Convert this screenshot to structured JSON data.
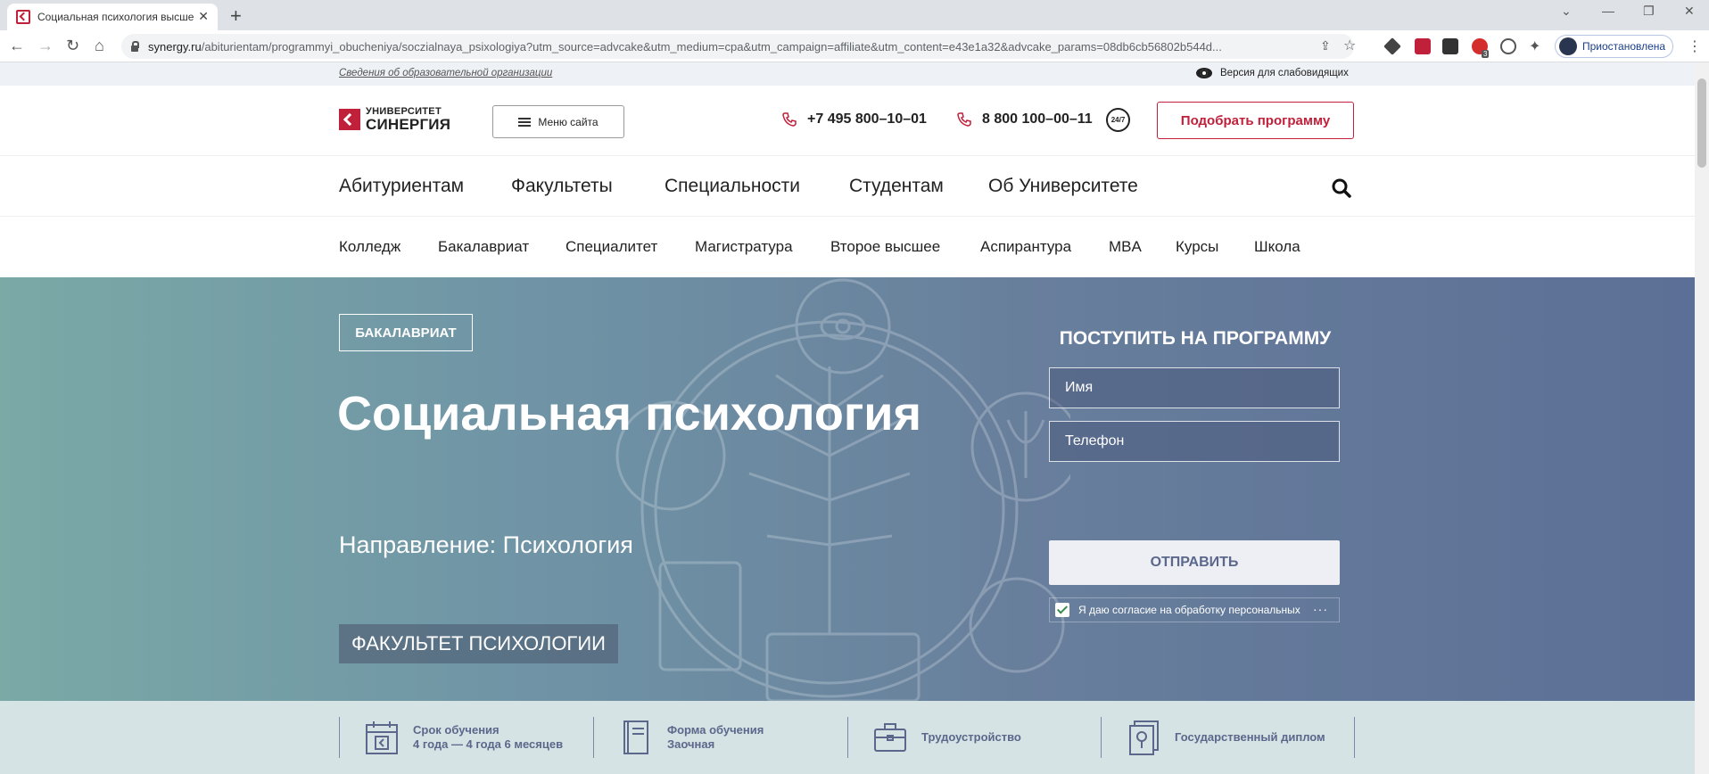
{
  "browser": {
    "tab_title": "Социальная психология высше",
    "url_host": "synergy.ru",
    "url_path": "/abiturientam/programmyi_obucheniya/soczialnaya_psixologiya?utm_source=advcake&utm_medium=cpa&utm_campaign=affiliate&utm_content=e43e1a32&advcake_params=08db6cb56802b544d...",
    "profile_label": "Приостановлена",
    "extension_badge": "3"
  },
  "infobar": {
    "org_info_link": "Сведения об образовательной организации",
    "vision_link": "Версия для слабовидящих"
  },
  "header": {
    "logo_line1": "УНИВЕРСИТЕТ",
    "logo_line2": "СИНЕРГИЯ",
    "menu_label": "Меню сайта",
    "phone1": "+7 495 800–10–01",
    "phone2": "8 800 100–00–11",
    "clock_label": "24/7",
    "cta_label": "Подобрать программу"
  },
  "main_nav": [
    "Абитуриентам",
    "Факультеты",
    "Специальности",
    "Студентам",
    "Об Университете"
  ],
  "sub_nav": [
    "Колледж",
    "Бакалавриат",
    "Специалитет",
    "Магистратура",
    "Второе высшее",
    "Аспирантура",
    "MBA",
    "Курсы",
    "Школа"
  ],
  "hero": {
    "badge": "БАКАЛАВРИАТ",
    "title": "Социальная психология",
    "direction": "Направление: Психология",
    "faculty": "ФАКУЛЬТЕТ ПСИХОЛОГИИ"
  },
  "form": {
    "title": "ПОСТУПИТЬ НА ПРОГРАММУ",
    "name_placeholder": "Имя",
    "phone_placeholder": "Телефон",
    "submit_label": "ОТПРАВИТЬ",
    "consent_text": "Я даю согласие на обработку персональных",
    "consent_checked": true,
    "consent_more": "···"
  },
  "features": [
    {
      "icon": "calendar-icon",
      "line1": "Срок обучения",
      "line2": "4 года — 4 года 6 месяцев"
    },
    {
      "icon": "book-icon",
      "line1": "Форма обучения",
      "line2": "Заочная"
    },
    {
      "icon": "briefcase-icon",
      "line1": "Трудоустройство",
      "line2": ""
    },
    {
      "icon": "diploma-icon",
      "line1": "Государственный диплом",
      "line2": ""
    }
  ],
  "colors": {
    "brand_red": "#c0203a",
    "hero_gradient_start": "#7aa9a6",
    "hero_gradient_end": "#5c6f96",
    "feature_text": "#5b678b",
    "features_bg": "#d5e3e4"
  }
}
